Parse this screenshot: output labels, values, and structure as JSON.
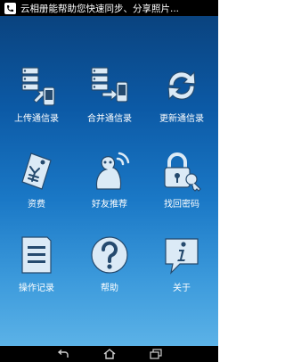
{
  "statusbar": {
    "notification_text": "云相册能帮助您快速同步、分享照片..."
  },
  "menu": [
    {
      "label": "上传通信录",
      "icon": "upload-contacts-icon"
    },
    {
      "label": "合并通信录",
      "icon": "merge-contacts-icon"
    },
    {
      "label": "更新通信录",
      "icon": "refresh-contacts-icon"
    },
    {
      "label": "资费",
      "icon": "price-tag-icon"
    },
    {
      "label": "好友推荐",
      "icon": "friend-recommend-icon"
    },
    {
      "label": "找回密码",
      "icon": "password-recovery-icon"
    },
    {
      "label": "操作记录",
      "icon": "operation-log-icon"
    },
    {
      "label": "帮助",
      "icon": "help-icon"
    },
    {
      "label": "关于",
      "icon": "about-icon"
    }
  ],
  "navbar": {
    "buttons": [
      "back-icon",
      "home-icon",
      "recent-apps-icon"
    ]
  },
  "colors": {
    "background_top": "#0a3f78",
    "background_bottom": "#63b8ea",
    "icon_primary": "#dbeaf6"
  }
}
